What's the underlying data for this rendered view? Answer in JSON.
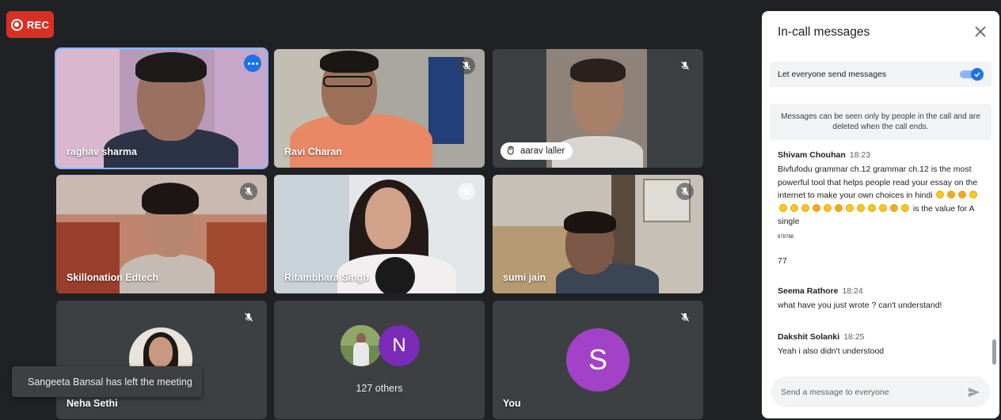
{
  "recording": {
    "label": "REC"
  },
  "tiles": [
    {
      "name": "raghav sharma",
      "speaking": true
    },
    {
      "name": "Ravi Charan"
    },
    {
      "name": "aarav laller",
      "hand_raised": true
    },
    {
      "name": "Skillonation Edtech"
    },
    {
      "name": "Ritambhara Singh"
    },
    {
      "name": "sumi jain"
    },
    {
      "name": "Neha Sethi"
    },
    {
      "name": "127 others",
      "avatar_letter": "N"
    },
    {
      "name": "You",
      "avatar_letter": "S"
    }
  ],
  "toast": {
    "text": "Sangeeta Bansal has left the meeting"
  },
  "chat": {
    "title": "In-call messages",
    "setting_label": "Let everyone send messages",
    "setting_enabled": true,
    "info": "Messages can be seen only by people in the call and are deleted when the call ends.",
    "messages": [
      {
        "sender": "Shivam Chouhan",
        "time": "18:23",
        "text_part1": "Bivfufodu grammar ch.12 grammar ch.12 is the most powerful tool that helps people read your essay on the internet to make your own choices in hindi",
        "text_part2": "is the value for A single",
        "extra_small": "878788",
        "extra_line": "77"
      },
      {
        "sender": "Seema Rathore",
        "time": "18:24",
        "text": "what have you just wrote ? can't understand!"
      },
      {
        "sender": "Dakshit Solanki",
        "time": "18:25",
        "text": "Yeah i also didn't understood"
      }
    ],
    "input_placeholder": "Send a message to everyone"
  },
  "colors": {
    "background": "#202124",
    "accent": "#1a73e8",
    "rec": "#d93025",
    "avatar_s": "#a142c7"
  }
}
